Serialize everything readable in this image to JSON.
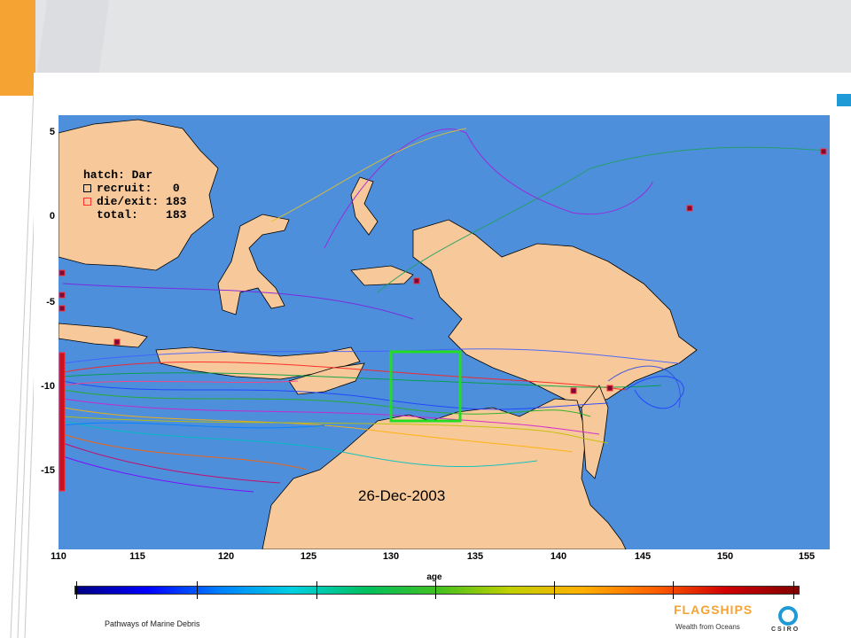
{
  "map": {
    "legend": {
      "hatch": "hatch: Dar",
      "recruit": "recruit:   0",
      "die_exit": "die/exit: 183",
      "total": "total:    183",
      "recruit_color": "#000000",
      "die_color": "#ff3030"
    },
    "date": "26-Dec-2003",
    "y_ticks": [
      "5",
      "0",
      "-5",
      "-10",
      "-15"
    ],
    "x_ticks": [
      "110",
      "115",
      "120",
      "125",
      "130",
      "135",
      "140",
      "145",
      "150",
      "155"
    ],
    "colorbar_label": "age",
    "ocean_color": "#4d8fdb",
    "land_color": "#f7c99a",
    "box_color": "#22dd22"
  },
  "footer": {
    "title": "Pathways of Marine Debris",
    "flagships": "FLAGSHIPS",
    "tagline": "Wealth from Oceans",
    "csiro": "CSIRO"
  }
}
